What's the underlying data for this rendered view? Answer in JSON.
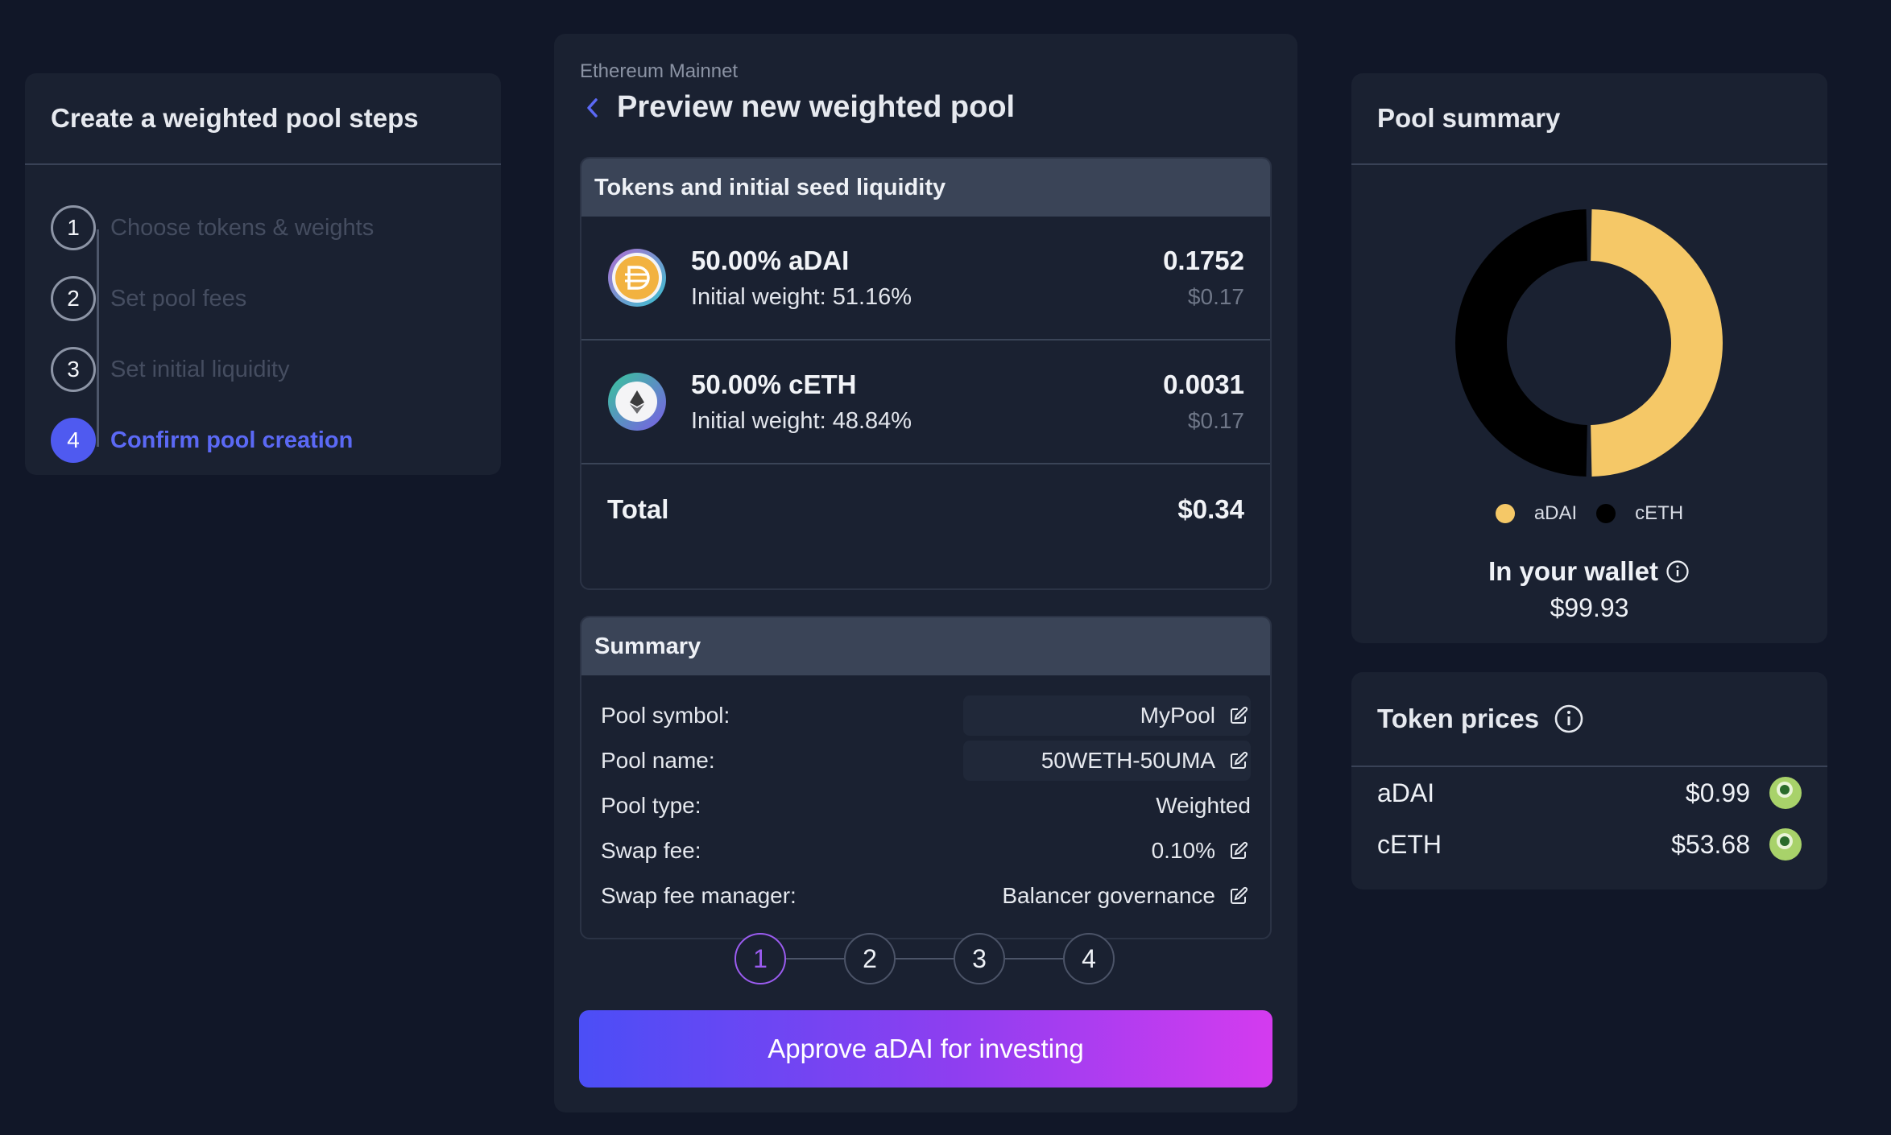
{
  "steps": {
    "title": "Create a weighted pool steps",
    "items": [
      {
        "num": "1",
        "label": "Choose tokens & weights"
      },
      {
        "num": "2",
        "label": "Set pool fees"
      },
      {
        "num": "3",
        "label": "Set initial liquidity"
      },
      {
        "num": "4",
        "label": "Confirm pool creation"
      }
    ],
    "active_step": 4
  },
  "main": {
    "network": "Ethereum Mainnet",
    "title": "Preview new weighted pool",
    "tokens_panel": {
      "heading": "Tokens and initial seed liquidity",
      "tokens": [
        {
          "title": "50.00% aDAI",
          "weight": "Initial weight: 51.16%",
          "amount": "0.1752",
          "usd": "$0.17",
          "logo_icon": "adai-logo-icon"
        },
        {
          "title": "50.00% cETH",
          "weight": "Initial weight: 48.84%",
          "amount": "0.0031",
          "usd": "$0.17",
          "logo_icon": "ceth-logo-icon"
        }
      ],
      "total_label": "Total",
      "total_value": "$0.34"
    },
    "summary_panel": {
      "heading": "Summary",
      "rows": [
        {
          "label": "Pool symbol:",
          "value": "MyPool",
          "editable": true
        },
        {
          "label": "Pool name:",
          "value": "50WETH-50UMA",
          "editable": true
        },
        {
          "label": "Pool type:",
          "value": "Weighted",
          "editable": false
        },
        {
          "label": "Swap fee:",
          "value": "0.10%",
          "editable": true
        },
        {
          "label": "Swap fee manager:",
          "value": "Balancer governance",
          "editable": true
        }
      ]
    },
    "stepper": [
      "1",
      "2",
      "3",
      "4"
    ],
    "stepper_active": 1,
    "approve_label": "Approve aDAI for investing"
  },
  "pool_summary": {
    "title": "Pool summary",
    "chart_data": {
      "type": "pie",
      "categories": [
        "aDAI",
        "cETH"
      ],
      "values": [
        50,
        50
      ],
      "colors": [
        "#f5c867",
        "#000000"
      ],
      "legend": "bottom"
    },
    "wallet_label": "In your wallet",
    "wallet_value": "$99.93"
  },
  "token_prices": {
    "title": "Token prices",
    "rows": [
      {
        "name": "aDAI",
        "price": "$0.99",
        "icon": "coingecko-icon"
      },
      {
        "name": "cETH",
        "price": "$53.68",
        "icon": "coingecko-icon"
      }
    ]
  },
  "colors": {
    "background": "#111728",
    "card": "#1a2131",
    "accent": "#4f5af0",
    "adai": "#f5c867",
    "ceth": "#000000"
  }
}
